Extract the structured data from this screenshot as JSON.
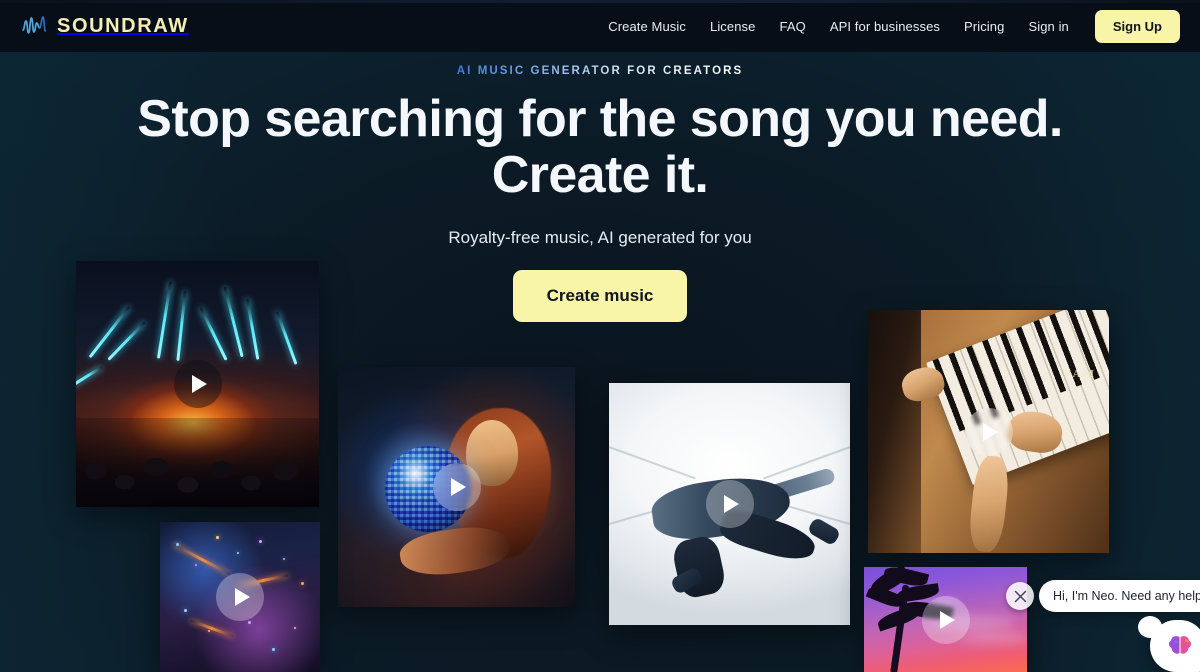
{
  "brand": {
    "name": "SOUNDRAW",
    "logo_icon": "waveform-icon",
    "logo_text_color": "#f4eeb4",
    "logo_mark_color": "#4ea8e0"
  },
  "header": {
    "background": "#080e18",
    "nav": [
      {
        "label": "Create Music",
        "name": "nav-create-music"
      },
      {
        "label": "License",
        "name": "nav-license"
      },
      {
        "label": "FAQ",
        "name": "nav-faq"
      },
      {
        "label": "API for businesses",
        "name": "nav-api-for-businesses"
      },
      {
        "label": "Pricing",
        "name": "nav-pricing"
      },
      {
        "label": "Sign in",
        "name": "nav-sign-in"
      }
    ],
    "signup_label": "Sign Up",
    "signup_bg": "#f8f4a8",
    "signup_text_color": "#11151c"
  },
  "hero": {
    "eyebrow": "AI MUSIC GENERATOR FOR CREATORS",
    "headline_line1": "Stop searching for the song you need.",
    "headline_line2": "Create it.",
    "subhead": "Royalty-free music, AI generated for you",
    "cta_label": "Create music",
    "cta_bg": "#f8f4a8",
    "cta_text_color": "#11151c",
    "background_color": "#0b1a24"
  },
  "gallery": {
    "play_icon": "play-icon",
    "cards": [
      {
        "name": "video-card-concert",
        "alt": "Concert stage with cyan laser beams over a crowd"
      },
      {
        "name": "video-card-disco",
        "alt": "Woman with a mirrorball in warm and blue light"
      },
      {
        "name": "video-card-dancer",
        "alt": "Breakdancer mid-move in a bright white corridor"
      },
      {
        "name": "video-card-piano",
        "alt": "Hands playing a wooden Yamaha upright piano"
      },
      {
        "name": "video-card-city",
        "alt": "Aerial night cityscape with neon blue and purple lights"
      },
      {
        "name": "video-card-sunset",
        "alt": "Palm trees silhouetted against a purple and pink sunset"
      }
    ]
  },
  "chat": {
    "message": "Hi, I'm Neo. Need any help?",
    "close_icon": "close-icon",
    "launcher_icon": "brain-icon",
    "bubble_bg": "#ffffff",
    "bubble_text_color": "#1c2230"
  }
}
